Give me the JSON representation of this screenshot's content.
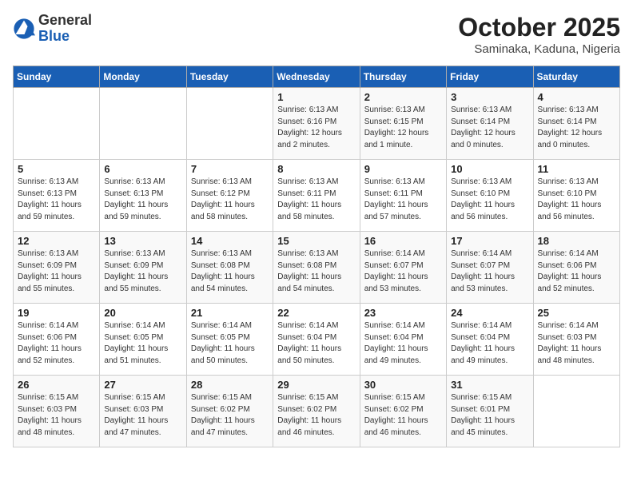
{
  "header": {
    "logo_general": "General",
    "logo_blue": "Blue",
    "month": "October 2025",
    "location": "Saminaka, Kaduna, Nigeria"
  },
  "weekdays": [
    "Sunday",
    "Monday",
    "Tuesday",
    "Wednesday",
    "Thursday",
    "Friday",
    "Saturday"
  ],
  "weeks": [
    [
      {
        "day": "",
        "info": ""
      },
      {
        "day": "",
        "info": ""
      },
      {
        "day": "",
        "info": ""
      },
      {
        "day": "1",
        "info": "Sunrise: 6:13 AM\nSunset: 6:16 PM\nDaylight: 12 hours\nand 2 minutes."
      },
      {
        "day": "2",
        "info": "Sunrise: 6:13 AM\nSunset: 6:15 PM\nDaylight: 12 hours\nand 1 minute."
      },
      {
        "day": "3",
        "info": "Sunrise: 6:13 AM\nSunset: 6:14 PM\nDaylight: 12 hours\nand 0 minutes."
      },
      {
        "day": "4",
        "info": "Sunrise: 6:13 AM\nSunset: 6:14 PM\nDaylight: 12 hours\nand 0 minutes."
      }
    ],
    [
      {
        "day": "5",
        "info": "Sunrise: 6:13 AM\nSunset: 6:13 PM\nDaylight: 11 hours\nand 59 minutes."
      },
      {
        "day": "6",
        "info": "Sunrise: 6:13 AM\nSunset: 6:13 PM\nDaylight: 11 hours\nand 59 minutes."
      },
      {
        "day": "7",
        "info": "Sunrise: 6:13 AM\nSunset: 6:12 PM\nDaylight: 11 hours\nand 58 minutes."
      },
      {
        "day": "8",
        "info": "Sunrise: 6:13 AM\nSunset: 6:11 PM\nDaylight: 11 hours\nand 58 minutes."
      },
      {
        "day": "9",
        "info": "Sunrise: 6:13 AM\nSunset: 6:11 PM\nDaylight: 11 hours\nand 57 minutes."
      },
      {
        "day": "10",
        "info": "Sunrise: 6:13 AM\nSunset: 6:10 PM\nDaylight: 11 hours\nand 56 minutes."
      },
      {
        "day": "11",
        "info": "Sunrise: 6:13 AM\nSunset: 6:10 PM\nDaylight: 11 hours\nand 56 minutes."
      }
    ],
    [
      {
        "day": "12",
        "info": "Sunrise: 6:13 AM\nSunset: 6:09 PM\nDaylight: 11 hours\nand 55 minutes."
      },
      {
        "day": "13",
        "info": "Sunrise: 6:13 AM\nSunset: 6:09 PM\nDaylight: 11 hours\nand 55 minutes."
      },
      {
        "day": "14",
        "info": "Sunrise: 6:13 AM\nSunset: 6:08 PM\nDaylight: 11 hours\nand 54 minutes."
      },
      {
        "day": "15",
        "info": "Sunrise: 6:13 AM\nSunset: 6:08 PM\nDaylight: 11 hours\nand 54 minutes."
      },
      {
        "day": "16",
        "info": "Sunrise: 6:14 AM\nSunset: 6:07 PM\nDaylight: 11 hours\nand 53 minutes."
      },
      {
        "day": "17",
        "info": "Sunrise: 6:14 AM\nSunset: 6:07 PM\nDaylight: 11 hours\nand 53 minutes."
      },
      {
        "day": "18",
        "info": "Sunrise: 6:14 AM\nSunset: 6:06 PM\nDaylight: 11 hours\nand 52 minutes."
      }
    ],
    [
      {
        "day": "19",
        "info": "Sunrise: 6:14 AM\nSunset: 6:06 PM\nDaylight: 11 hours\nand 52 minutes."
      },
      {
        "day": "20",
        "info": "Sunrise: 6:14 AM\nSunset: 6:05 PM\nDaylight: 11 hours\nand 51 minutes."
      },
      {
        "day": "21",
        "info": "Sunrise: 6:14 AM\nSunset: 6:05 PM\nDaylight: 11 hours\nand 50 minutes."
      },
      {
        "day": "22",
        "info": "Sunrise: 6:14 AM\nSunset: 6:04 PM\nDaylight: 11 hours\nand 50 minutes."
      },
      {
        "day": "23",
        "info": "Sunrise: 6:14 AM\nSunset: 6:04 PM\nDaylight: 11 hours\nand 49 minutes."
      },
      {
        "day": "24",
        "info": "Sunrise: 6:14 AM\nSunset: 6:04 PM\nDaylight: 11 hours\nand 49 minutes."
      },
      {
        "day": "25",
        "info": "Sunrise: 6:14 AM\nSunset: 6:03 PM\nDaylight: 11 hours\nand 48 minutes."
      }
    ],
    [
      {
        "day": "26",
        "info": "Sunrise: 6:15 AM\nSunset: 6:03 PM\nDaylight: 11 hours\nand 48 minutes."
      },
      {
        "day": "27",
        "info": "Sunrise: 6:15 AM\nSunset: 6:03 PM\nDaylight: 11 hours\nand 47 minutes."
      },
      {
        "day": "28",
        "info": "Sunrise: 6:15 AM\nSunset: 6:02 PM\nDaylight: 11 hours\nand 47 minutes."
      },
      {
        "day": "29",
        "info": "Sunrise: 6:15 AM\nSunset: 6:02 PM\nDaylight: 11 hours\nand 46 minutes."
      },
      {
        "day": "30",
        "info": "Sunrise: 6:15 AM\nSunset: 6:02 PM\nDaylight: 11 hours\nand 46 minutes."
      },
      {
        "day": "31",
        "info": "Sunrise: 6:15 AM\nSunset: 6:01 PM\nDaylight: 11 hours\nand 45 minutes."
      },
      {
        "day": "",
        "info": ""
      }
    ]
  ]
}
